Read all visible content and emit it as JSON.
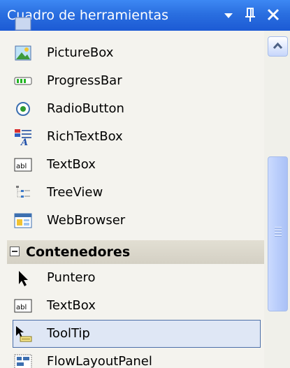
{
  "window": {
    "title": "Cuadro de herramientas",
    "icons": [
      "chevron-down-icon",
      "pin-icon",
      "close-icon"
    ]
  },
  "items_top": [
    {
      "label": "PictureBox",
      "icon": "picturebox-icon"
    },
    {
      "label": "ProgressBar",
      "icon": "progressbar-icon"
    },
    {
      "label": "RadioButton",
      "icon": "radiobutton-icon"
    },
    {
      "label": "RichTextBox",
      "icon": "richtextbox-icon"
    },
    {
      "label": "TextBox",
      "icon": "textbox-icon"
    },
    {
      "label": "TreeView",
      "icon": "treeview-icon"
    },
    {
      "label": "WebBrowser",
      "icon": "webbrowser-icon"
    }
  ],
  "category": {
    "label": "Contenedores",
    "expanded": true
  },
  "items_container": [
    {
      "label": "Puntero",
      "icon": "pointer-icon"
    },
    {
      "label": "TextBox",
      "icon": "textbox-icon"
    },
    {
      "label": "ToolTip",
      "icon": "tooltip-icon",
      "selected": true
    },
    {
      "label": "FlowLayoutPanel",
      "icon": "flowlayoutpanel-icon"
    }
  ],
  "colors": {
    "titlebar": "#2a6fe0",
    "selection_bg": "#dfe7f5",
    "selection_border": "#4b6fa8",
    "panel_bg": "#f4f3ee"
  }
}
